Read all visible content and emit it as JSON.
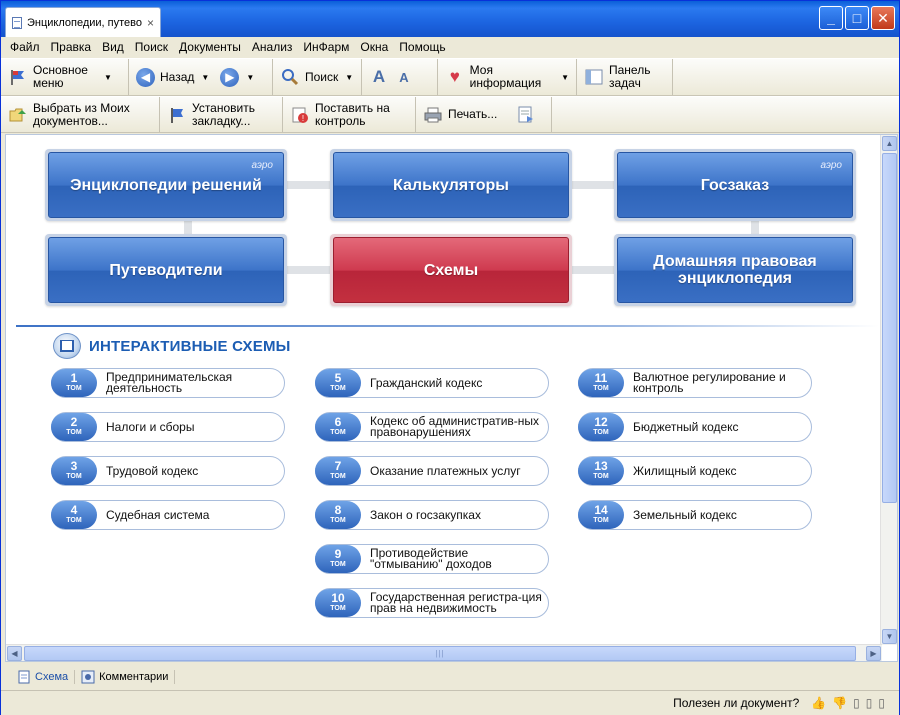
{
  "window": {
    "tab_title": "Энциклопедии, путево...",
    "tab_close": "×",
    "minimize": "_",
    "maximize": "□",
    "close": "✕"
  },
  "menu": [
    "Файл",
    "Правка",
    "Вид",
    "Поиск",
    "Документы",
    "Анализ",
    "ИнФарм",
    "Окна",
    "Помощь"
  ],
  "toolbar1": {
    "main_menu": "Основное меню",
    "back": "Назад",
    "search": "Поиск",
    "my_info": "Моя информация",
    "task_panel": "Панель задач"
  },
  "toolbar2": {
    "select_docs": "Выбрать из Моих документов...",
    "set_bookmark": "Установить закладку...",
    "put_control": "Поставить на контроль",
    "print": "Печать..."
  },
  "tiles": {
    "encyclopedias": "Энциклопедии решений",
    "calculators": "Калькуляторы",
    "goszakaz": "Госзаказ",
    "guides": "Путеводители",
    "schemes": "Схемы",
    "home_encyclopedia": "Домашняя правовая энциклопедия",
    "aero_badge": "аэро"
  },
  "section": {
    "title": "ИНТЕРАКТИВНЫЕ СХЕМЫ"
  },
  "vol_tom_label": "ТОМ",
  "volumes": [
    {
      "num": "1",
      "label": "Предпринимательская деятельность"
    },
    {
      "num": "2",
      "label": "Налоги и сборы"
    },
    {
      "num": "3",
      "label": "Трудовой кодекс"
    },
    {
      "num": "4",
      "label": "Судебная система"
    },
    {
      "num": "5",
      "label": "Гражданский кодекс"
    },
    {
      "num": "6",
      "label": "Кодекс об административ-ных правонарушениях"
    },
    {
      "num": "7",
      "label": "Оказание платежных услуг"
    },
    {
      "num": "8",
      "label": "Закон о госзакупках"
    },
    {
      "num": "9",
      "label": "Противодействие \"отмыванию\" доходов"
    },
    {
      "num": "10",
      "label": "Государственная регистра-ция прав на недвижимость"
    },
    {
      "num": "11",
      "label": "Валютное регулирование и контроль"
    },
    {
      "num": "12",
      "label": "Бюджетный кодекс"
    },
    {
      "num": "13",
      "label": "Жилищный кодекс"
    },
    {
      "num": "14",
      "label": "Земельный кодекс"
    }
  ],
  "bottom_tabs": {
    "scheme": "Схема",
    "comments": "Комментарии"
  },
  "status": {
    "question": "Полезен ли документ?"
  }
}
